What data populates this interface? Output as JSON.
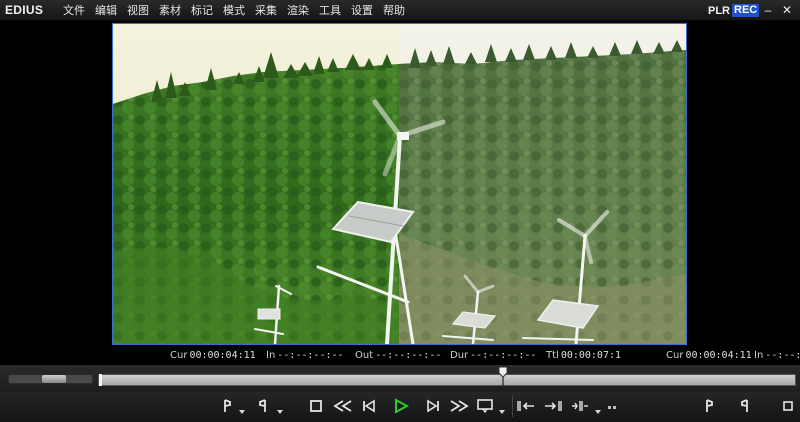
{
  "app": {
    "logo": "EDIUS"
  },
  "menu": {
    "items": [
      "文件",
      "编辑",
      "视图",
      "素材",
      "标记",
      "模式",
      "采集",
      "渲染",
      "工具",
      "设置",
      "帮助"
    ]
  },
  "mode_switch": {
    "player": "PLR",
    "recorder": "REC",
    "active": "REC"
  },
  "window": {
    "minimize": "–",
    "close": "✕"
  },
  "timecodes": {
    "cur_left": {
      "label": "Cur",
      "value": "00:00:04:11"
    },
    "in": {
      "label": "In",
      "value": "--:--:--:--"
    },
    "out": {
      "label": "Out",
      "value": "--:--:--:--"
    },
    "dur": {
      "label": "Dur",
      "value": "--:--:--:--"
    },
    "ttl": {
      "label": "Ttl",
      "value": "00:00:07:1"
    },
    "cur_right": {
      "label": "Cur",
      "value": "00:00:04:11"
    },
    "in_right": {
      "label": "In",
      "value": "--:--:--"
    }
  },
  "scrub": {
    "position_fraction": 0.58
  },
  "transport": {
    "buttons": [
      {
        "name": "set-in-button",
        "icon": "mark-in-icon"
      },
      {
        "name": "set-out-button",
        "icon": "mark-out-icon"
      },
      {
        "name": "stop-button",
        "icon": "stop-icon"
      },
      {
        "name": "rewind-button",
        "icon": "rewind-icon"
      },
      {
        "name": "step-back-button",
        "icon": "step-back-icon"
      },
      {
        "name": "play-button",
        "icon": "play-icon",
        "color": "#2ec832"
      },
      {
        "name": "step-forward-button",
        "icon": "step-forward-icon"
      },
      {
        "name": "fast-forward-button",
        "icon": "fast-forward-icon"
      },
      {
        "name": "loop-play-button",
        "icon": "loop-icon"
      },
      {
        "name": "insert-to-timeline-button",
        "icon": "insert-icon"
      },
      {
        "name": "overwrite-to-timeline-button",
        "icon": "overwrite-icon"
      },
      {
        "name": "split-edit-button",
        "icon": "split-icon"
      },
      {
        "name": "prev-edit-point-button",
        "icon": "prev-edit-icon"
      },
      {
        "name": "next-edit-point-button",
        "icon": "next-edit-icon"
      }
    ]
  },
  "colors": {
    "accent": "#2050c8",
    "frame_border": "#3c6fd0",
    "play": "#2ec832"
  }
}
